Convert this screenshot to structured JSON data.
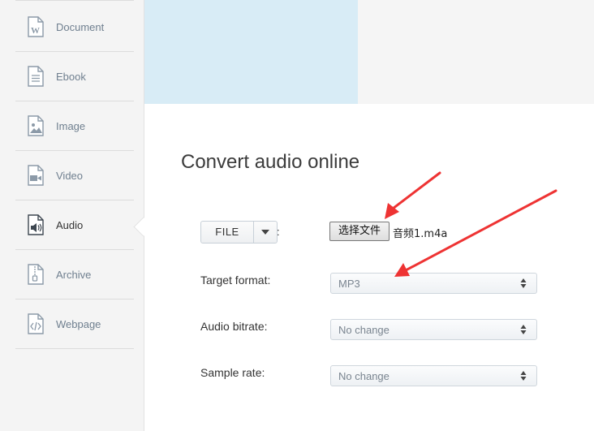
{
  "sidebar": {
    "items": [
      {
        "label": "Document",
        "icon": "document-icon",
        "active": false
      },
      {
        "label": "Ebook",
        "icon": "ebook-icon",
        "active": false
      },
      {
        "label": "Image",
        "icon": "image-icon",
        "active": false
      },
      {
        "label": "Video",
        "icon": "video-icon",
        "active": false
      },
      {
        "label": "Audio",
        "icon": "audio-icon",
        "active": true
      },
      {
        "label": "Archive",
        "icon": "archive-icon",
        "active": false
      },
      {
        "label": "Webpage",
        "icon": "webpage-icon",
        "active": false
      }
    ]
  },
  "main": {
    "title": "Convert audio online",
    "file_button": "FILE",
    "file_colon": ":",
    "choose_file_button": "选择文件",
    "file_name": "音频1.m4a",
    "fields": [
      {
        "label": "Target format:",
        "value": "MP3"
      },
      {
        "label": "Audio bitrate:",
        "value": "No change"
      },
      {
        "label": "Sample rate:",
        "value": "No change"
      }
    ]
  },
  "colors": {
    "banner": "#d8ecf6",
    "annotation_arrow": "#ee3333",
    "sidebar_bg": "#f4f4f4"
  }
}
